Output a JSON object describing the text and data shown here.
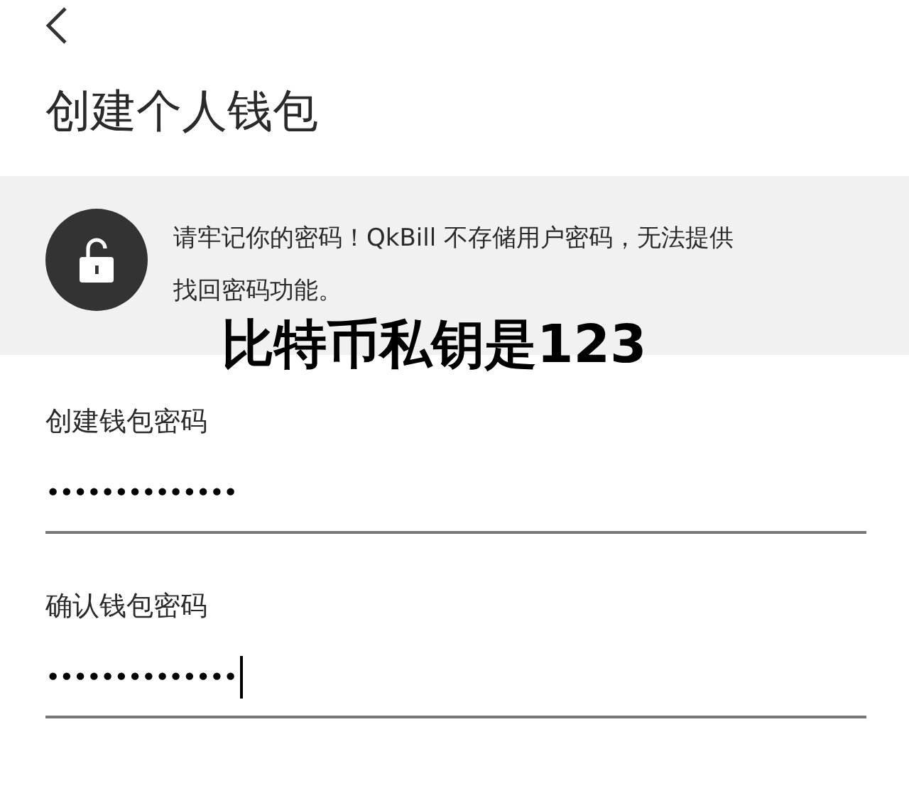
{
  "title": "创建个人钱包",
  "notice": {
    "text": "请牢记你的密码！QkBill 不存储用户密码，无法提供找回密码功能。"
  },
  "overlay_caption": "比特币私钥是123",
  "fields": [
    {
      "label": "创建钱包密码",
      "value": "••••••••••••••",
      "focused": false
    },
    {
      "label": "确认钱包密码",
      "value": "••••••••••••••",
      "focused": true
    }
  ]
}
